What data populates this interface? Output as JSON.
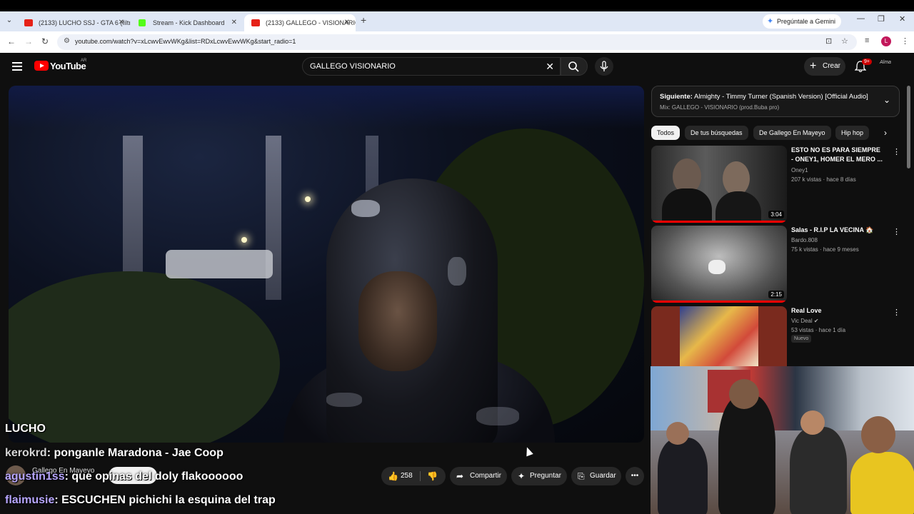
{
  "browser": {
    "tabs": [
      {
        "label": "(2133) LUCHO SSJ - GTA 6 (filtr",
        "favicon": "youtube-icon",
        "active": false
      },
      {
        "label": "Stream - Kick Dashboard",
        "favicon": "kick-icon",
        "active": false
      },
      {
        "label": "(2133) GALLEGO - VISIONARIO",
        "favicon": "youtube-icon",
        "active": true
      }
    ],
    "gemini_label": "Pregúntale a Gemini",
    "url": "youtube.com/watch?v=xLcwvEwvWKg&list=RDxLcwvEwvWKg&start_radio=1",
    "profile_initial": "L"
  },
  "youtube": {
    "logo_text": "YouTube",
    "country": "AR",
    "search_query": "GALLEGO VISIONARIO",
    "create_label": "Crear",
    "notifications_badge": "9+",
    "avatar_text": "Alma"
  },
  "player": {
    "chat": [
      {
        "user": "",
        "text": "LUCHO"
      },
      {
        "user": "kerokrd",
        "text": ": ponganle Maradona - Jae Coop"
      },
      {
        "user": "agustin1ss",
        "text": ": que opinas del doly flakoooooo"
      },
      {
        "user": "flaimusie",
        "text": ": ESCUCHEN pichichi la esquina del trap"
      }
    ],
    "channel_name": "Gallego En Mayeyo",
    "like_count": "258",
    "share_label": "Compartir",
    "ask_label": "Preguntar",
    "save_label": "Guardar"
  },
  "sidebar": {
    "up_next_label": "Siguiente:",
    "up_next_title": "Almighty - Timmy Turner (Spanish Version) [Official Audio]",
    "mix_label": "Mix: GALLEGO - VISIONARIO (prod.Buba pro)",
    "chips": [
      "Todos",
      "De tus búsquedas",
      "De Gallego En Mayeyo",
      "Hip hop"
    ],
    "recommendations": [
      {
        "title": "ESTO NO ES PARA SIEMPRE - ONEY1, HOMER EL MERO ...",
        "channel": "Oney1",
        "stats": "207 k vistas · hace 8 días",
        "duration": "3:04",
        "progress": 1.0
      },
      {
        "title": "Salas - R.I.P LA VECINA 🏠",
        "channel": "Bardo.808",
        "stats": "75 k vistas · hace 9 meses",
        "duration": "2:15",
        "progress": 1.0
      },
      {
        "title": "Real Love",
        "channel": "Vic Deal",
        "stats": "53 vistas · hace 1 día",
        "badge": "Nuevo",
        "verified": true
      }
    ]
  }
}
